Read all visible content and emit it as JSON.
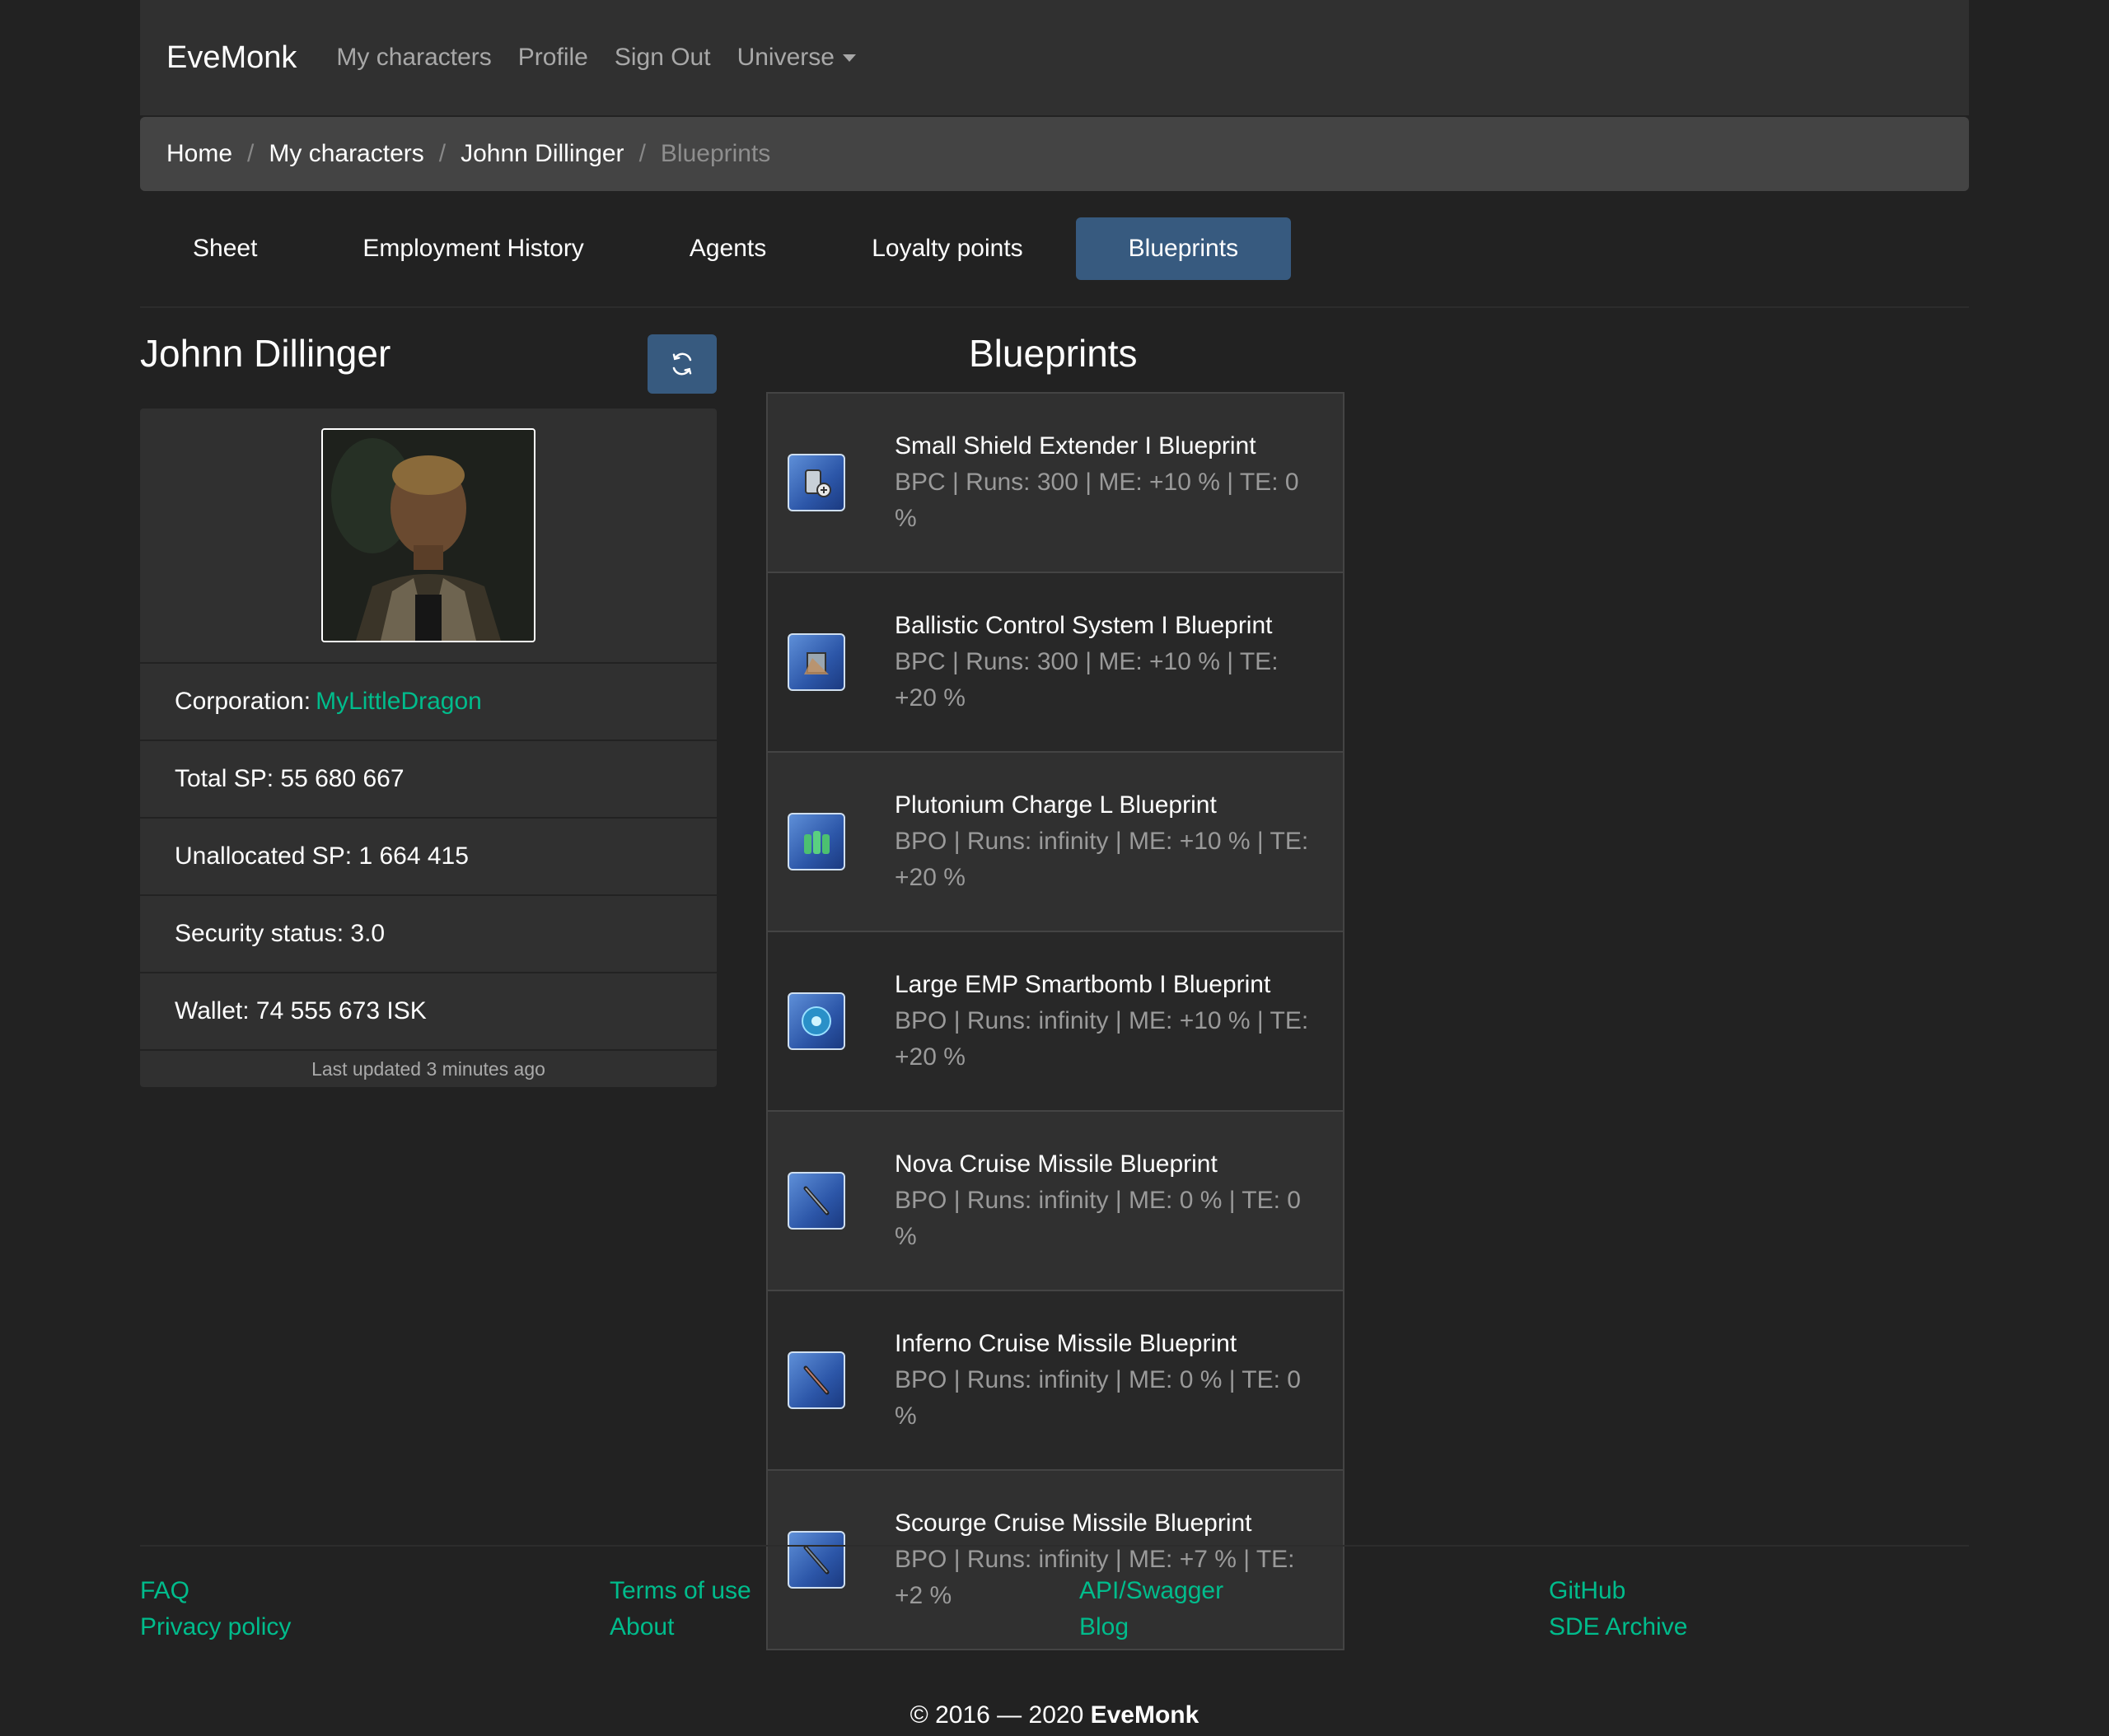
{
  "navbar": {
    "brand": "EveMonk",
    "links": [
      "My characters",
      "Profile",
      "Sign Out"
    ],
    "universe_label": "Universe"
  },
  "breadcrumb": {
    "items": [
      "Home",
      "My characters",
      "Johnn Dillinger"
    ],
    "active": "Blueprints",
    "separator": "/"
  },
  "tabs": [
    "Sheet",
    "Employment History",
    "Agents",
    "Loyalty points",
    "Blueprints"
  ],
  "active_tab": "Blueprints",
  "character": {
    "name": "Johnn Dillinger",
    "corporation_label": "Corporation:",
    "corporation": "MyLittleDragon",
    "total_sp": "Total SP: 55 680 667",
    "unallocated_sp": "Unallocated SP: 1 664 415",
    "security_status": "Security status: 3.0",
    "wallet": "Wallet: 74 555 673 ISK",
    "last_updated": "Last updated 3 minutes ago"
  },
  "blueprints": {
    "title": "Blueprints",
    "items": [
      {
        "name": "Small Shield Extender I Blueprint",
        "meta": "BPC | Runs: 300 | ME: +10 % | TE: 0 %",
        "icon": "shield-extender-icon"
      },
      {
        "name": "Ballistic Control System I Blueprint",
        "meta": "BPC | Runs: 300 | ME: +10 % | TE: +20 %",
        "icon": "ballistic-control-icon"
      },
      {
        "name": "Plutonium Charge L Blueprint",
        "meta": "BPO | Runs: infinity | ME: +10 % | TE: +20 %",
        "icon": "plutonium-charge-icon"
      },
      {
        "name": "Large EMP Smartbomb I Blueprint",
        "meta": "BPO | Runs: infinity | ME: +10 % | TE: +20 %",
        "icon": "smartbomb-icon"
      },
      {
        "name": "Nova Cruise Missile Blueprint",
        "meta": "BPO | Runs: infinity | ME: 0 % | TE: 0 %",
        "icon": "cruise-missile-icon"
      },
      {
        "name": "Inferno Cruise Missile Blueprint",
        "meta": "BPO | Runs: infinity | ME: 0 % | TE: 0 %",
        "icon": "cruise-missile-icon"
      },
      {
        "name": "Scourge Cruise Missile Blueprint",
        "meta": "BPO | Runs: infinity | ME: +7 % | TE: +2 %",
        "icon": "cruise-missile-icon"
      }
    ]
  },
  "footer": {
    "col1": [
      "FAQ",
      "Privacy policy"
    ],
    "col2": [
      "Terms of use",
      "About"
    ],
    "col3": [
      "API/Swagger",
      "Blog"
    ],
    "col4": [
      "GitHub",
      "SDE Archive"
    ],
    "copyright_prefix": "© 2016 — 2020",
    "copyright_brand": "EveMonk"
  },
  "colors": {
    "background": "#222222",
    "accent": "#00bc8c",
    "primary": "#375a7f"
  }
}
